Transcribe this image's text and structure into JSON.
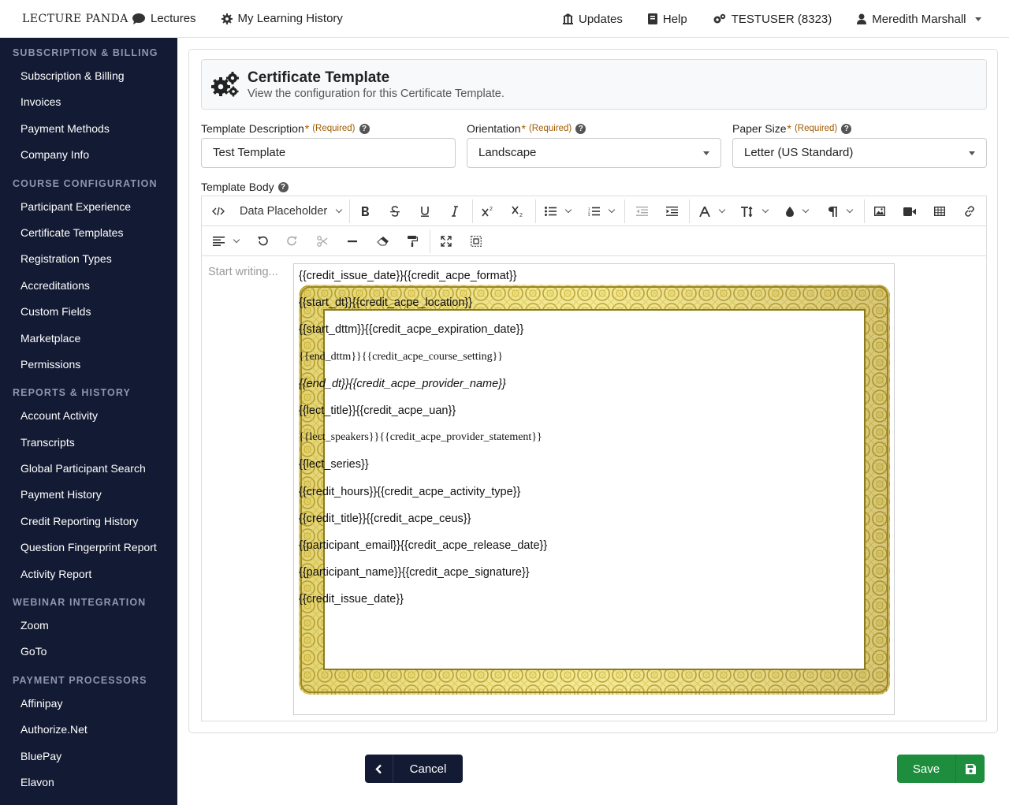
{
  "nav": {
    "logo_text": "LECTURE PANDA",
    "lectures": "Lectures",
    "history": "My Learning History",
    "updates": "Updates",
    "help": "Help",
    "account": "TESTUSER (8323)",
    "user": "Meredith Marshall"
  },
  "sidebar": {
    "sections": [
      {
        "title": "SUBSCRIPTION & BILLING",
        "items": [
          "Subscription & Billing",
          "Invoices",
          "Payment Methods",
          "Company Info"
        ]
      },
      {
        "title": "COURSE CONFIGURATION",
        "items": [
          "Participant Experience",
          "Certificate Templates",
          "Registration Types",
          "Accreditations",
          "Custom Fields",
          "Marketplace",
          "Permissions"
        ]
      },
      {
        "title": "REPORTS & HISTORY",
        "items": [
          "Account Activity",
          "Transcripts",
          "Global Participant Search",
          "Payment History",
          "Credit Reporting History",
          "Question Fingerprint Report",
          "Activity Report"
        ]
      },
      {
        "title": "WEBINAR INTEGRATION",
        "items": [
          "Zoom",
          "GoTo"
        ]
      },
      {
        "title": "PAYMENT PROCESSORS",
        "items": [
          "Affinipay",
          "Authorize.Net",
          "BluePay",
          "Elavon"
        ]
      }
    ]
  },
  "header": {
    "title": "Certificate Template",
    "subtitle": "View the configuration for this Certificate Template."
  },
  "form": {
    "required_mark": "*",
    "required_text": "(Required)",
    "help_glyph": "?",
    "description_label": "Template Description",
    "description_value": "Test Template",
    "orientation_label": "Orientation",
    "orientation_value": "Landscape",
    "paper_label": "Paper Size",
    "paper_value": "Letter (US Standard)",
    "body_label": "Template Body"
  },
  "editor": {
    "data_placeholder": "Data Placeholder",
    "placeholder": "Start writing...",
    "lines": [
      "{{credit_issue_date}}{{credit_acpe_format}}",
      "{{start_dt}}{{credit_acpe_location}}",
      "{{start_dttm}}{{credit_acpe_expiration_date}}",
      "{{end_dttm}}{{credit_acpe_course_setting}}",
      "{{end_dt}}{{credit_acpe_provider_name}}",
      "{{lect_title}}{{credit_acpe_uan}}",
      "{{lect_speakers}}{{credit_acpe_provider_statement}}",
      "{{lect_series}}",
      "{{credit_hours}}{{credit_acpe_activity_type}}",
      "{{credit_title}}{{credit_acpe_ceus}}",
      "{{participant_email}}{{credit_acpe_release_date}}",
      "{{participant_name}}{{credit_acpe_signature}}",
      "{{credit_issue_date}}"
    ]
  },
  "buttons": {
    "cancel": "Cancel",
    "save": "Save"
  },
  "colors": {
    "sidebar_bg": "#131a33",
    "save_green": "#1e8e3e",
    "border_gold": "#c9b23a"
  }
}
